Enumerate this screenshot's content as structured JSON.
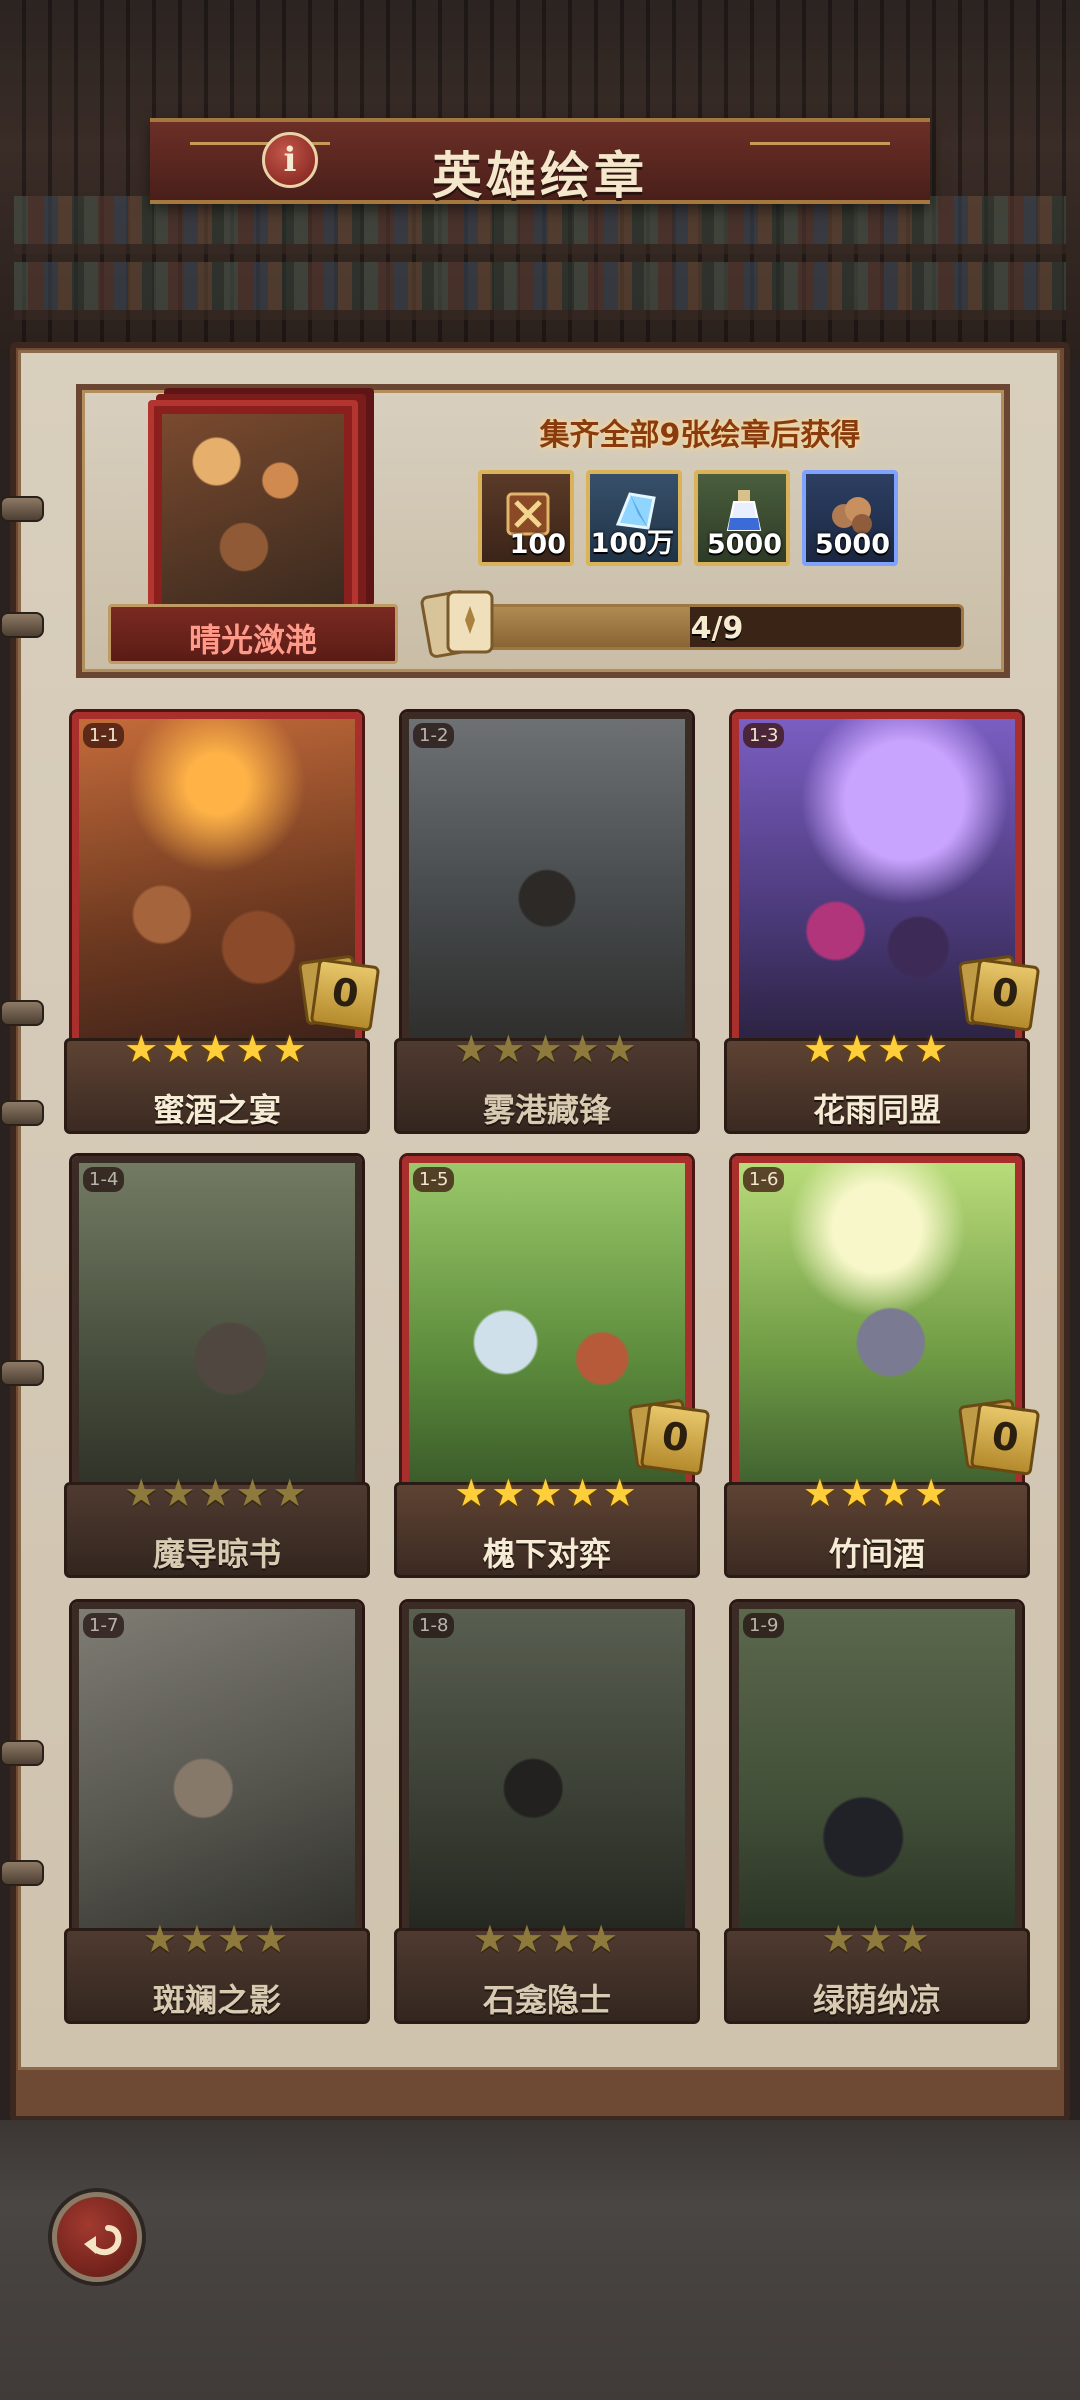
{
  "header": {
    "title": "英雄绘章",
    "info_icon": "info-icon"
  },
  "album": {
    "name": "晴光潋滟",
    "reward_title": "集齐全部9张绘章后获得",
    "rewards": [
      {
        "icon": "hero-token-icon",
        "amount": "100"
      },
      {
        "icon": "crystal-icon",
        "amount": "100万"
      },
      {
        "icon": "potion-icon",
        "amount": "5000"
      },
      {
        "icon": "ore-icon",
        "amount": "5000"
      }
    ],
    "progress_text": "4/9",
    "progress_fraction": 0.444
  },
  "cards": [
    {
      "code": "1-1",
      "name": "蜜酒之宴",
      "stars": 5,
      "count": "0",
      "unlocked": true
    },
    {
      "code": "1-2",
      "name": "雾港藏锋",
      "stars": 5,
      "count": "",
      "unlocked": false
    },
    {
      "code": "1-3",
      "name": "花雨同盟",
      "stars": 4,
      "count": "0",
      "unlocked": true
    },
    {
      "code": "1-4",
      "name": "魔导晾书",
      "stars": 5,
      "count": "",
      "unlocked": false
    },
    {
      "code": "1-5",
      "name": "槐下对弈",
      "stars": 5,
      "count": "0",
      "unlocked": true
    },
    {
      "code": "1-6",
      "name": "竹间酒",
      "stars": 4,
      "count": "0",
      "unlocked": true
    },
    {
      "code": "1-7",
      "name": "斑斓之影",
      "stars": 4,
      "count": "",
      "unlocked": false
    },
    {
      "code": "1-8",
      "name": "石龛隐士",
      "stars": 4,
      "count": "",
      "unlocked": false
    },
    {
      "code": "1-9",
      "name": "绿荫纳凉",
      "stars": 3,
      "count": "",
      "unlocked": false
    }
  ],
  "footer": {
    "back_icon": "back-arrow-icon"
  }
}
